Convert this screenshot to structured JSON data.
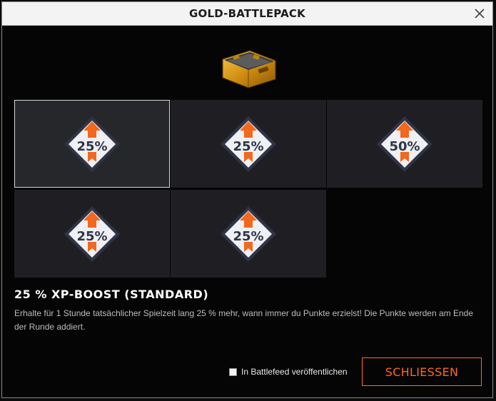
{
  "dialog": {
    "title": "GOLD-BATTLEPACK"
  },
  "items": [
    {
      "label": "25%",
      "selected": true
    },
    {
      "label": "25%",
      "selected": false
    },
    {
      "label": "50%",
      "selected": false
    },
    {
      "label": "25%",
      "selected": false
    },
    {
      "label": "25%",
      "selected": false
    }
  ],
  "detail": {
    "title": "25 % XP-BOOST (STANDARD)",
    "description": "Erhalte für 1 Stunde tatsächlicher Spielzeit lang 25 % mehr, wann immer du Punkte erzielst! Die Punkte werden am Ende der Runde addiert."
  },
  "footer": {
    "share_label": "In Battlefeed veröffentlichen",
    "share_checked": false,
    "close_label": "SCHLIESSEN"
  },
  "colors": {
    "accent": "#ff6a1a",
    "badge_navy": "#2f3446",
    "badge_arrow": "#f2681e"
  },
  "icons": {
    "close": "close-icon",
    "case": "briefcase-icon",
    "badge": "xp-boost-badge-icon"
  }
}
